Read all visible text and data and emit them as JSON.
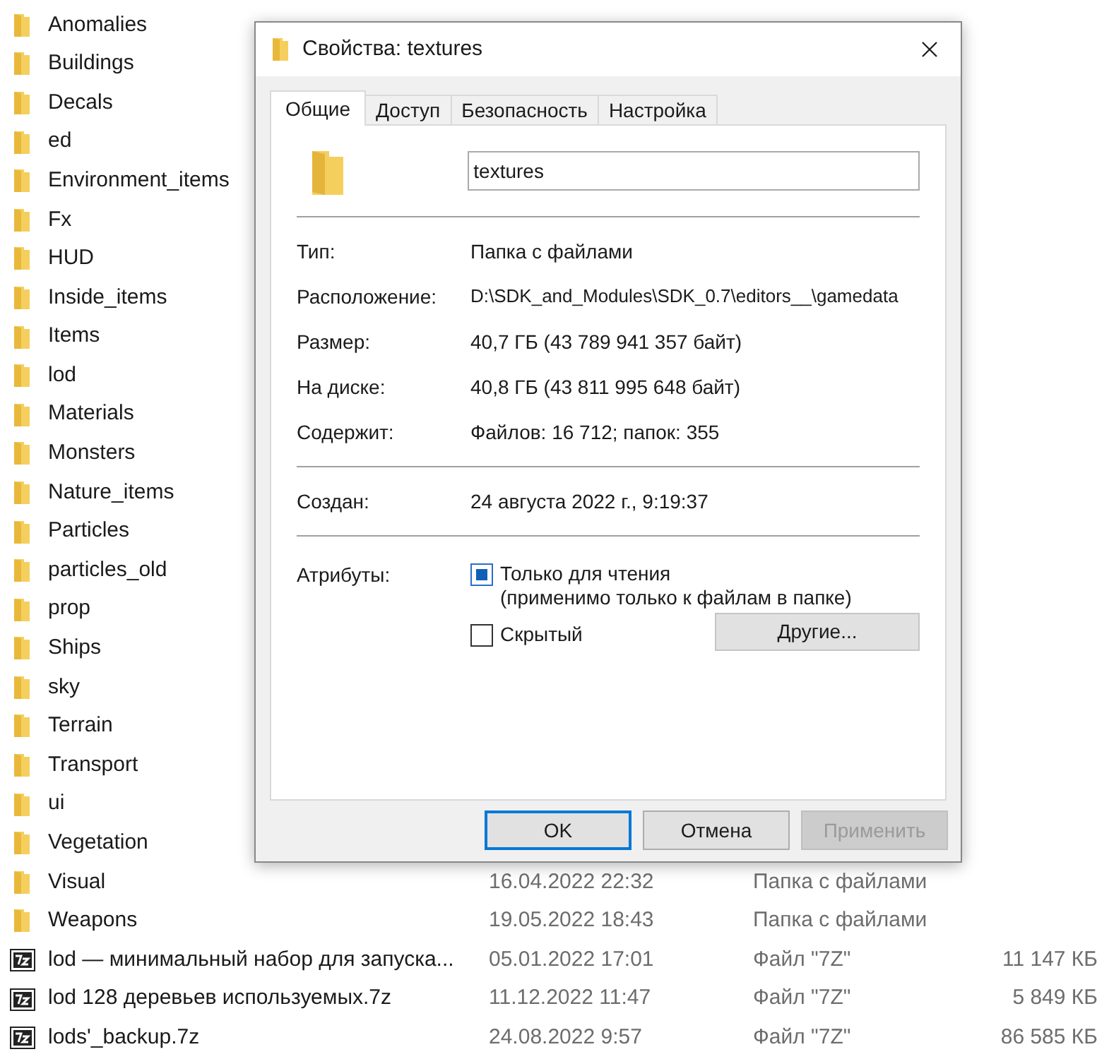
{
  "explorer": {
    "rows": [
      {
        "name": "Anomalies",
        "kind": "folder"
      },
      {
        "name": "Buildings",
        "kind": "folder"
      },
      {
        "name": "Decals",
        "kind": "folder"
      },
      {
        "name": "ed",
        "kind": "folder"
      },
      {
        "name": "Environment_items",
        "kind": "folder"
      },
      {
        "name": "Fx",
        "kind": "folder"
      },
      {
        "name": "HUD",
        "kind": "folder"
      },
      {
        "name": "Inside_items",
        "kind": "folder"
      },
      {
        "name": "Items",
        "kind": "folder"
      },
      {
        "name": "lod",
        "kind": "folder"
      },
      {
        "name": "Materials",
        "kind": "folder"
      },
      {
        "name": "Monsters",
        "kind": "folder"
      },
      {
        "name": "Nature_items",
        "kind": "folder"
      },
      {
        "name": "Particles",
        "kind": "folder"
      },
      {
        "name": "particles_old",
        "kind": "folder"
      },
      {
        "name": "prop",
        "kind": "folder"
      },
      {
        "name": "Ships",
        "kind": "folder"
      },
      {
        "name": "sky",
        "kind": "folder"
      },
      {
        "name": "Terrain",
        "kind": "folder"
      },
      {
        "name": "Transport",
        "kind": "folder"
      },
      {
        "name": "ui",
        "kind": "folder"
      },
      {
        "name": "Vegetation",
        "kind": "folder"
      },
      {
        "name": "Visual",
        "kind": "folder",
        "date": "16.04.2022 22:32",
        "type": "Папка с файлами"
      },
      {
        "name": "Weapons",
        "kind": "folder",
        "date": "19.05.2022 18:43",
        "type": "Папка с файлами"
      },
      {
        "name": "lod — минимальный набор для запуска...",
        "kind": "archive",
        "date": "05.01.2022 17:01",
        "type": "Файл \"7Z\"",
        "size": "11 147 КБ"
      },
      {
        "name": "lod 128 деревьев используемых.7z",
        "kind": "archive",
        "date": "11.12.2022 11:47",
        "type": "Файл \"7Z\"",
        "size": "5 849 КБ"
      },
      {
        "name": "lods'_backup.7z",
        "kind": "archive",
        "date": "24.08.2022 9:57",
        "type": "Файл \"7Z\"",
        "size": "86 585 КБ"
      }
    ]
  },
  "dialog": {
    "title": "Свойства: textures",
    "tabs": [
      {
        "label": "Общие",
        "selected": true
      },
      {
        "label": "Доступ",
        "selected": false
      },
      {
        "label": "Безопасность",
        "selected": false
      },
      {
        "label": "Настройка",
        "selected": false
      }
    ],
    "name_field": {
      "value": "textures"
    },
    "sections": [
      [
        {
          "label": "Тип:",
          "value": "Папка с файлами"
        },
        {
          "label": "Расположение:",
          "value": "D:\\SDK_and_Modules\\SDK_0.7\\editors__\\gamedata"
        },
        {
          "label": "Размер:",
          "value": "40,7 ГБ (43 789 941 357 байт)"
        },
        {
          "label": "На диске:",
          "value": "40,8 ГБ (43 811 995 648 байт)"
        },
        {
          "label": "Содержит:",
          "value": "Файлов: 16 712; папок: 355"
        }
      ],
      [
        {
          "label": "Создан:",
          "value": "24 августа 2022 г., 9:19:37"
        }
      ]
    ],
    "attributes": {
      "label": "Атрибуты:",
      "checkboxes": [
        {
          "label": "Только для чтения",
          "note": "(применимо только к файлам в папке)",
          "checked": false,
          "indeterminate": true
        },
        {
          "label": "Скрытый",
          "checked": false,
          "indeterminate": false
        }
      ],
      "other_button": "Другие..."
    },
    "buttons": [
      {
        "label": "OK",
        "default": true,
        "disabled": false
      },
      {
        "label": "Отмена",
        "default": false,
        "disabled": false
      },
      {
        "label": "Применить",
        "default": false,
        "disabled": true
      }
    ]
  }
}
